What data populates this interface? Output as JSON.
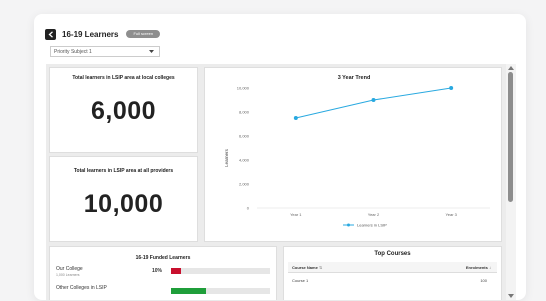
{
  "header": {
    "title": "16-19 Learners",
    "badge": "Full screen"
  },
  "filter": {
    "selected": "Priority Subject 1"
  },
  "kpis": [
    {
      "label": "Total learners in LSIP area at local colleges",
      "value": "6,000"
    },
    {
      "label": "Total learners in LSIP area at all providers",
      "value": "10,000"
    }
  ],
  "trend": {
    "title": "3 Year Trend",
    "ylabel": "Learners",
    "legend": "Learners in LSIP",
    "color": "#29a9e0"
  },
  "chart_data": {
    "type": "line",
    "title": "3 Year Trend",
    "xlabel": "",
    "ylabel": "Learners",
    "categories": [
      "Year 1",
      "Year 2",
      "Year 3"
    ],
    "series": [
      {
        "name": "Learners in LSIP",
        "values": [
          7500,
          9000,
          10000
        ]
      }
    ],
    "ylim": [
      0,
      10000
    ],
    "yticks": [
      "0",
      "2,000",
      "4,000",
      "6,000",
      "8,000",
      "10,000"
    ],
    "grid": false,
    "legend_position": "bottom"
  },
  "funded": {
    "title": "16-19 Funded Learners",
    "rows": [
      {
        "label": "Our College",
        "sub": "1,000 Learners",
        "pct": "10%",
        "fraction": 0.1,
        "color": "#c8102e"
      },
      {
        "label": "Other Colleges in LSIP",
        "sub": "",
        "pct": "",
        "fraction": 0.35,
        "color": "#1f9e3a"
      }
    ]
  },
  "top_courses": {
    "title": "Top Courses",
    "col_course": "Course Name",
    "col_enrol": "Enrolments",
    "rows": [
      {
        "name": "Course 1",
        "enrolments": "100"
      }
    ]
  }
}
